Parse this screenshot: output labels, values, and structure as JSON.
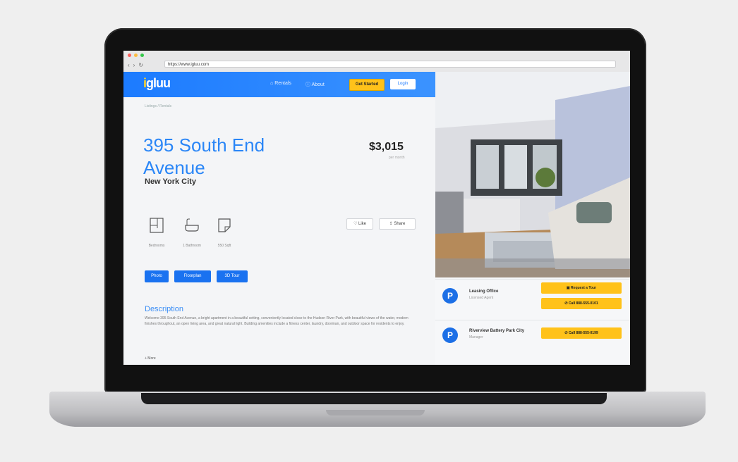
{
  "browser": {
    "url": "https://www.igluu.com",
    "nav_back": "‹",
    "nav_forward": "›",
    "nav_reload": "↻"
  },
  "header": {
    "logo_main": "glu",
    "logo_i": "i",
    "logo_end": "u",
    "nav_items": [
      "Rentals",
      "About"
    ],
    "signup_label": "Get Started",
    "login_label": "Login"
  },
  "listing": {
    "breadcrumb": "Listings / Rentals",
    "title": "395 South End Avenue",
    "city": "New York City",
    "price": "$3,015",
    "price_sub": "per month",
    "features": [
      {
        "label": "Bedrooms"
      },
      {
        "label": "1 Bathroom"
      },
      {
        "label": "550 Sqft"
      }
    ],
    "save_label": "Like",
    "share_label": "Share",
    "tags": [
      "Photo",
      "Floorplan",
      "3D Tour"
    ],
    "description_heading": "Description",
    "description_text": "Welcome 395 South End Avenue, a bright apartment in a beautiful setting, conveniently located close to the Hudson River Park, with beautiful views of the water, modern finishes throughout, an open living area, and great natural light. Building amenities include a fitness center, laundry, doorman, and outdoor space for residents to enjoy.",
    "more_label": "+ More"
  },
  "agents": [
    {
      "initial": "P",
      "name": "Leasing Office",
      "role": "Licensed Agent",
      "cta1": "Request a Tour",
      "cta2": "Call 888-555-0101"
    },
    {
      "initial": "P",
      "name": "Riverview Battery Park City",
      "role": "Manager",
      "cta1": "Call 888-555-0199"
    }
  ],
  "colors": {
    "brand_blue": "#1c7bff",
    "accent_yellow": "#ffc21a"
  }
}
